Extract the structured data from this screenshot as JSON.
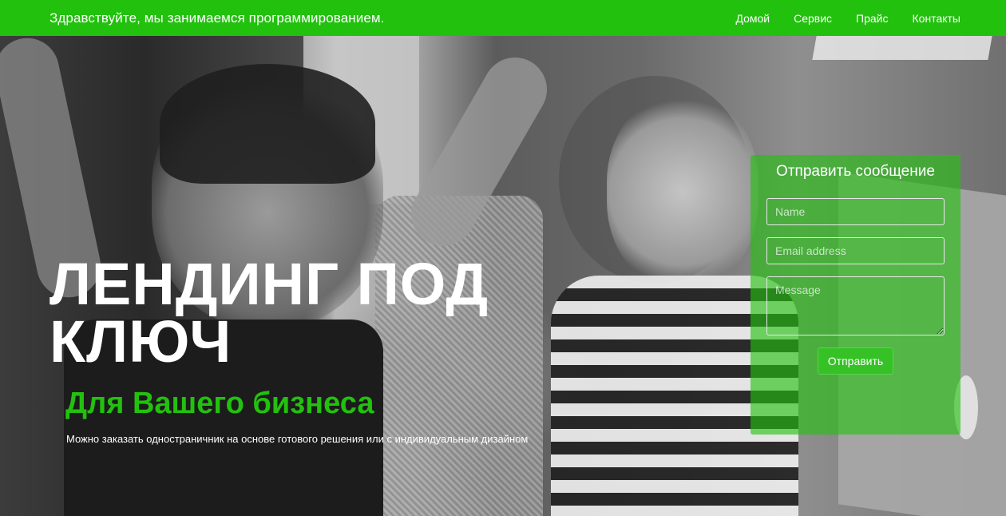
{
  "navbar": {
    "brand": "Здравствуйте, мы занимаемся программированием.",
    "links": [
      "Домой",
      "Сервис",
      "Прайс",
      "Контакты"
    ],
    "background_color": "#22c10e"
  },
  "hero": {
    "headline_line1": "ЛЕНДИНГ ПОД",
    "headline_line2": "КЛЮЧ",
    "subheadline": "Для Вашего бизнеса",
    "description": "Можно заказать одностраничник на основе готового решения или с индивидуальным дизайном",
    "accent_color": "#22c10e"
  },
  "contact_form": {
    "title": "Отправить сообщение",
    "name_placeholder": "Name",
    "email_placeholder": "Email address",
    "message_placeholder": "Message",
    "submit_label": "Отправить"
  }
}
